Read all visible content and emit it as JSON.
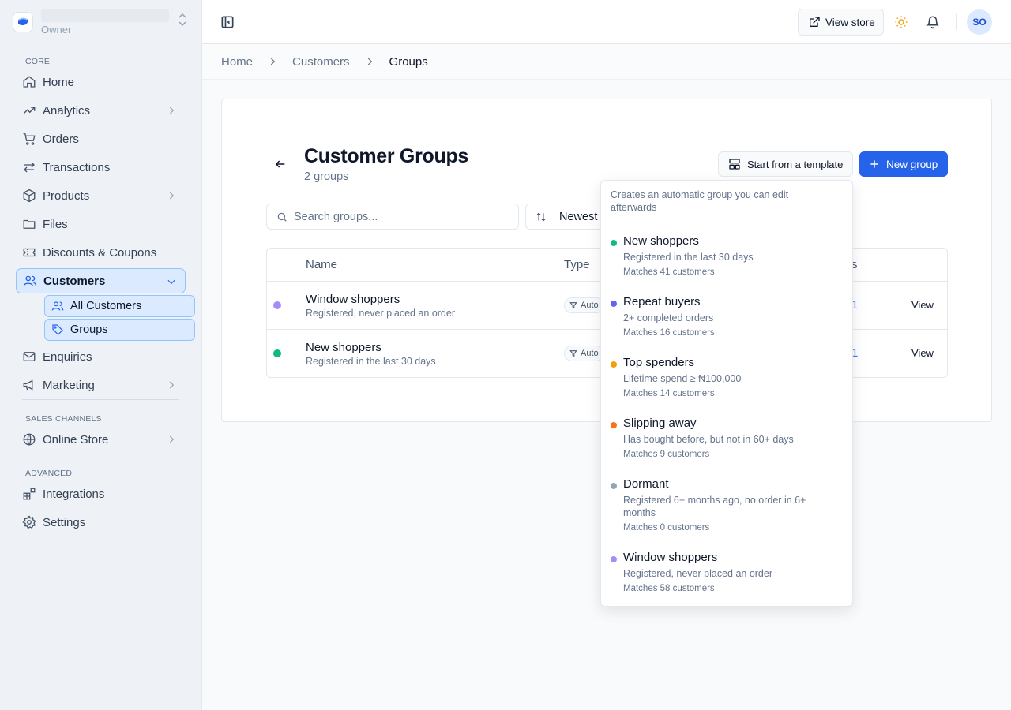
{
  "store": {
    "role": "Owner"
  },
  "sidebar": {
    "sections": {
      "core": "CORE",
      "sales": "SALES CHANNELS",
      "advanced": "ADVANCED"
    },
    "items": {
      "home": "Home",
      "analytics": "Analytics",
      "orders": "Orders",
      "transactions": "Transactions",
      "products": "Products",
      "files": "Files",
      "discounts": "Discounts & Coupons",
      "customers": "Customers",
      "all_customers": "All Customers",
      "groups": "Groups",
      "enquiries": "Enquiries",
      "marketing": "Marketing",
      "online_store": "Online Store",
      "integrations": "Integrations",
      "settings": "Settings"
    }
  },
  "topbar": {
    "view_store": "View store",
    "avatar_initials": "SO"
  },
  "breadcrumb": [
    "Home",
    "Customers",
    "Groups"
  ],
  "page": {
    "title": "Customer Groups",
    "subtitle": "2 groups",
    "template_button": "Start from a template",
    "new_button": "New group",
    "search_placeholder": "Search groups...",
    "sort_label": "Newest"
  },
  "table": {
    "columns": {
      "name": "Name",
      "type": "Type",
      "customers_tail": "s"
    },
    "rows": [
      {
        "name": "Window shoppers",
        "desc": "Registered, never placed an order",
        "type": "Auto",
        "count_tail": "1",
        "action": "View",
        "color": "#a78bfa"
      },
      {
        "name": "New shoppers",
        "desc": "Registered in the last 30 days",
        "type": "Auto",
        "count_tail": "1",
        "action": "View",
        "color": "#10b981"
      }
    ]
  },
  "template_menu": {
    "header": "Creates an automatic group you can edit afterwards",
    "items": [
      {
        "name": "New shoppers",
        "desc": "Registered in the last 30 days",
        "match": "Matches 41 customers",
        "color": "#10b981"
      },
      {
        "name": "Repeat buyers",
        "desc": "2+ completed orders",
        "match": "Matches 16 customers",
        "color": "#6366f1"
      },
      {
        "name": "Top spenders",
        "desc": "Lifetime spend ≥ ₦100,000",
        "match": "Matches 14 customers",
        "color": "#f59e0b"
      },
      {
        "name": "Slipping away",
        "desc": "Has bought before, but not in 60+ days",
        "match": "Matches 9 customers",
        "color": "#f97316"
      },
      {
        "name": "Dormant",
        "desc": "Registered 6+ months ago, no order in 6+ months",
        "match": "Matches 0 customers",
        "color": "#94a3b8"
      },
      {
        "name": "Window shoppers",
        "desc": "Registered, never placed an order",
        "match": "Matches 58 customers",
        "color": "#a78bfa"
      }
    ]
  }
}
